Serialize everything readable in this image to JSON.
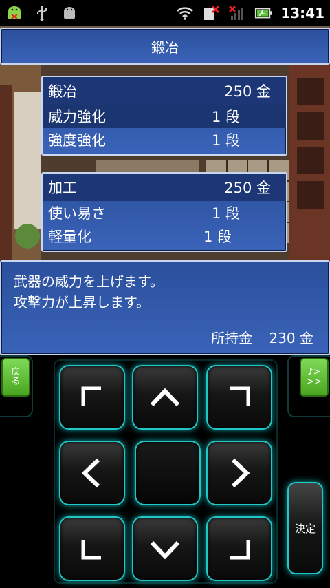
{
  "statusbar": {
    "time": "13:41",
    "icons": [
      "android-icon",
      "usb-icon",
      "android-debug-icon",
      "wifi-icon",
      "sim-error-icon",
      "signal-icon",
      "battery-icon"
    ]
  },
  "title": "鍛冶",
  "smithing": {
    "header": "鍛冶",
    "cost": "250 金",
    "rows": [
      {
        "label": "威力強化",
        "value": "1 段",
        "selected": true
      },
      {
        "label": "強度強化",
        "value": "1 段",
        "selected": false
      }
    ]
  },
  "processing": {
    "header": "加工",
    "cost": "250 金",
    "rows": [
      {
        "label": "使い易さ",
        "value": "1 段"
      },
      {
        "label": "軽量化",
        "value": "1 段"
      }
    ]
  },
  "description": {
    "line1": "武器の威力を上げます。",
    "line2": "攻撃力が上昇します。",
    "money_label": "所持金",
    "money_value": "230 金"
  },
  "controller": {
    "back_label_1": "戻",
    "back_label_2": "る",
    "music_label_1": "♪>",
    "music_label_2": ">>",
    "ok_label": "決定"
  },
  "colors": {
    "panel": "#2b4f9c",
    "panel_header": "#1c3676",
    "glow": "#1fc7c7",
    "side_button": "#6cc943"
  }
}
